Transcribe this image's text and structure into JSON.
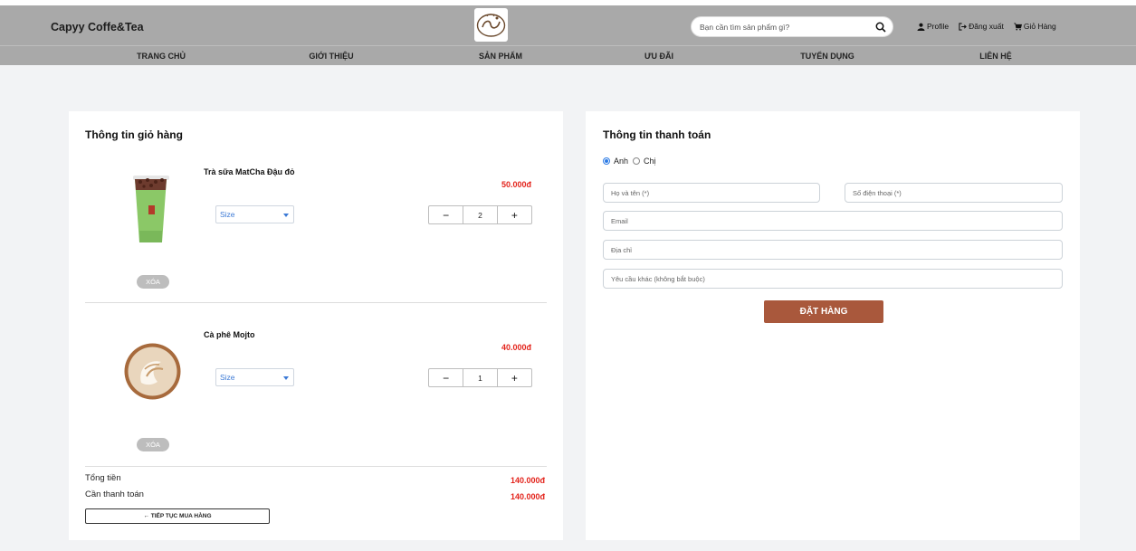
{
  "header": {
    "brand": "Capyy Coffe&Tea",
    "search_placeholder": "Bạn cần tìm sản phẩm gì?",
    "links": {
      "profile": "Profile",
      "logout": "Đăng xuất",
      "cart": "Giỏ Hàng"
    }
  },
  "nav": [
    "TRANG CHỦ",
    "GIỚI THIỆU",
    "SẢN PHẨM",
    "ƯU ĐÃI",
    "TUYỂN DỤNG",
    "LIÊN HỆ"
  ],
  "cart": {
    "title": "Thông tin giỏ hàng",
    "items": [
      {
        "name": "Trà sữa MatCha Đậu đỏ",
        "price": "50.000đ",
        "size_label": "Size",
        "qty": "2",
        "delete": "XÓA"
      },
      {
        "name": "Cà phê Mojto",
        "price": "40.000đ",
        "size_label": "Size",
        "qty": "1",
        "delete": "XÓA"
      }
    ],
    "total_label": "Tổng tiền",
    "total_value": "140.000đ",
    "due_label": "Cần thanh toán",
    "due_value": "140.000đ",
    "continue_label": "← TIẾP TỤC MUA HÀNG"
  },
  "payment": {
    "title": "Thông tin thanh toán",
    "gender_options": [
      "Anh",
      "Chị"
    ],
    "gender_selected": "Anh",
    "placeholders": {
      "name": "Họ và tên (*)",
      "phone": "Số điện thoại (*)",
      "email": "Email",
      "address": "Địa chỉ",
      "note": "Yêu cầu khác (không bắt buộc)"
    },
    "order_label": "ĐẶT HÀNG"
  },
  "colors": {
    "price": "#e3241c",
    "order_button": "#a9583c",
    "header": "#a9a9a9"
  }
}
